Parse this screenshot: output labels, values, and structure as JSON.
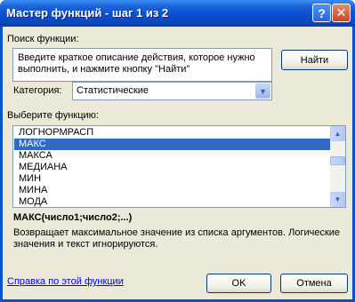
{
  "window": {
    "title": "Мастер функций - шаг 1 из 2",
    "help_glyph": "?",
    "close_glyph": "✕"
  },
  "search": {
    "label": "Поиск функции:",
    "text": "Введите краткое описание действия, которое нужно выполнить, и нажмите кнопку \"Найти\"",
    "find_button": "Найти"
  },
  "category": {
    "label": "Категория:",
    "value": "Статистические"
  },
  "functions": {
    "label": "Выберите функцию:",
    "items": [
      "ЛОГНОРМРАСП",
      "МАКС",
      "МАКСА",
      "МЕДИАНА",
      "МИН",
      "МИНА",
      "МОДА"
    ],
    "selected_index": 1
  },
  "details": {
    "syntax": "МАКС(число1;число2;...)",
    "description": "Возвращает максимальное значение из списка аргументов. Логические значения и текст игнорируются."
  },
  "footer": {
    "help_link": "Справка по этой функции",
    "ok": "OK",
    "cancel": "Отмена"
  }
}
